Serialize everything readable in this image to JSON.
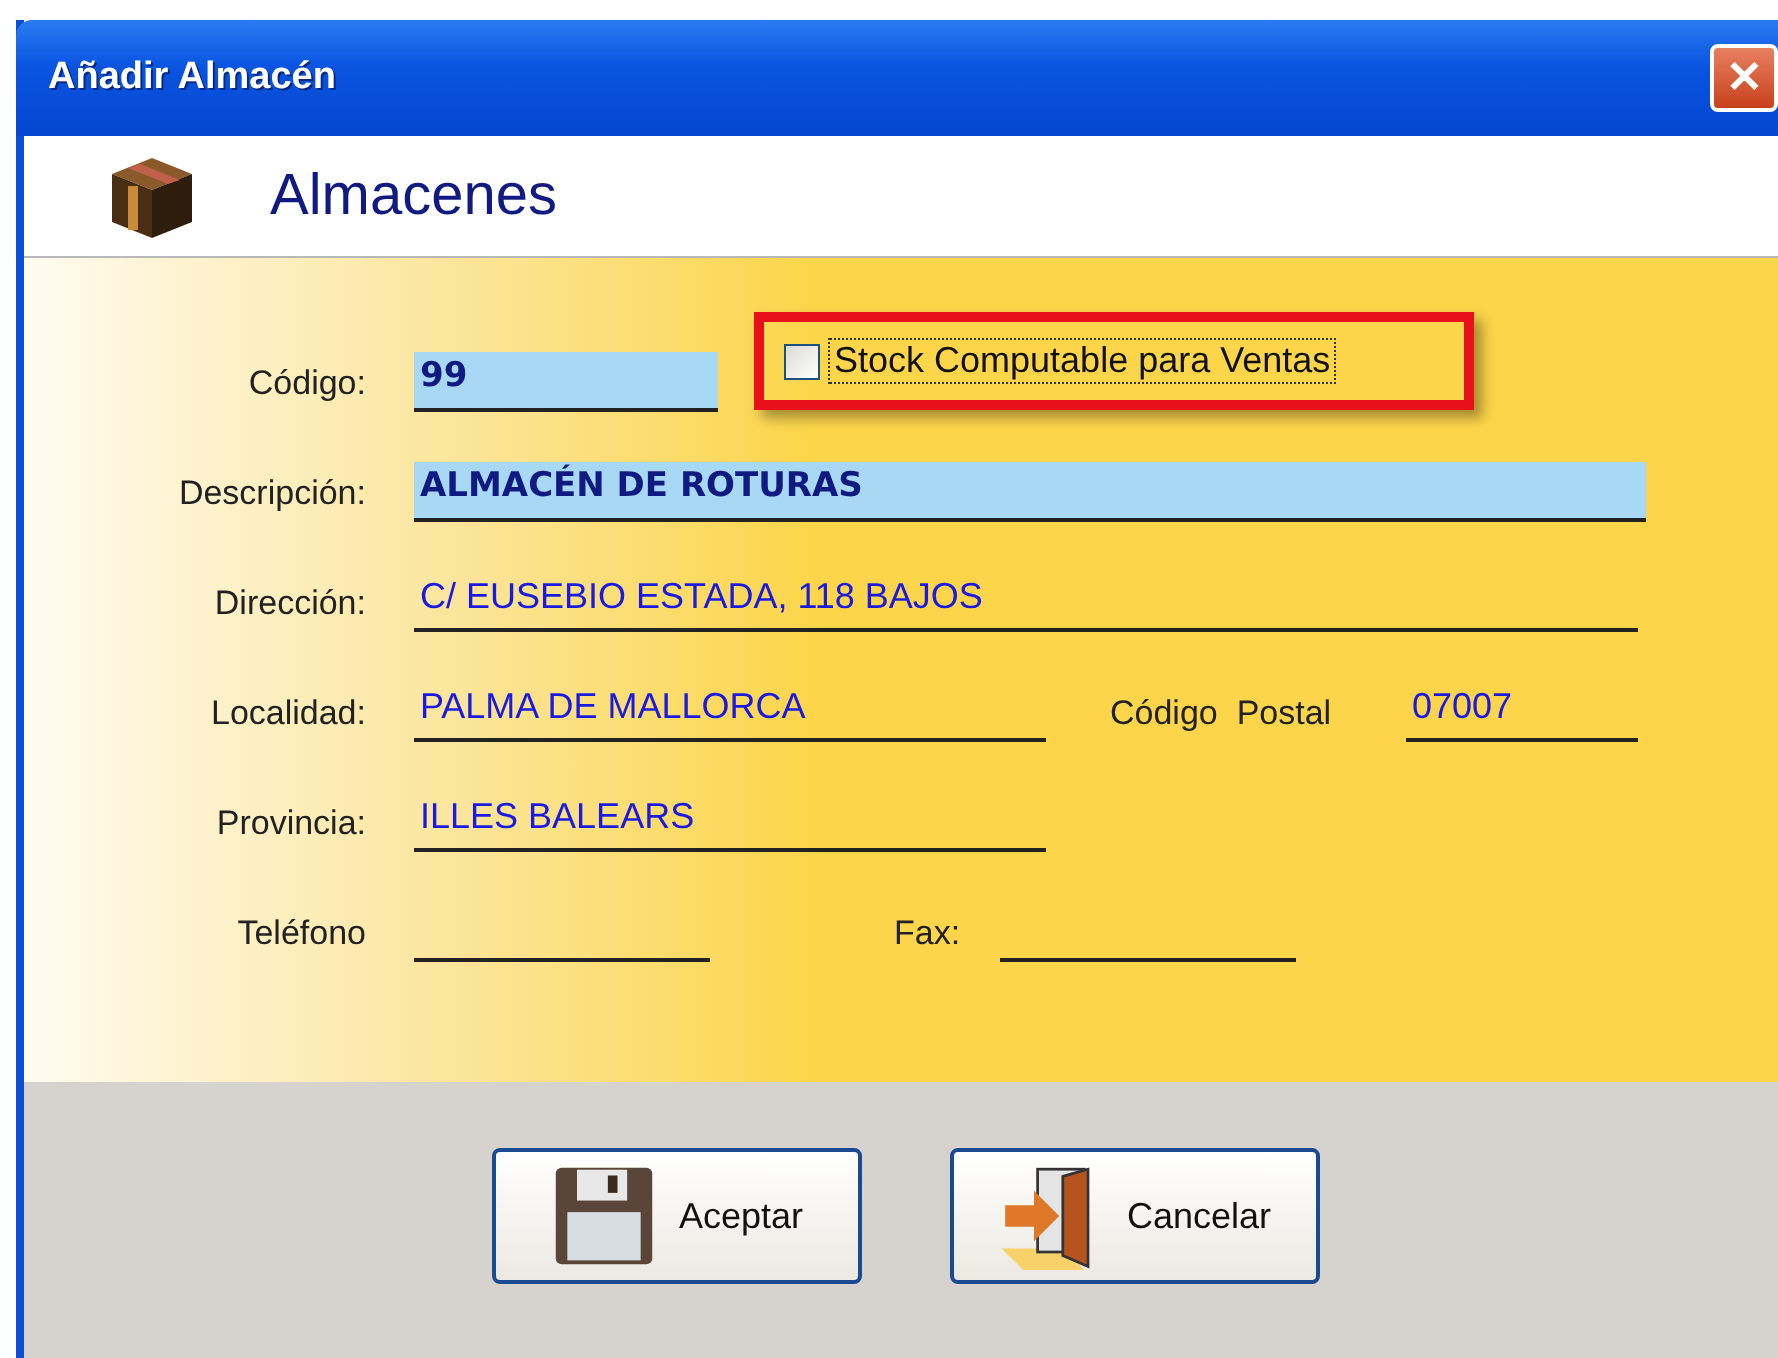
{
  "window": {
    "title": "Añadir Almacén",
    "close": "✕"
  },
  "header": {
    "title": "Almacenes"
  },
  "rows": [
    {
      "label": "Código:",
      "field": {
        "value": "99",
        "highlighted": true
      },
      "checkbox": {
        "label": "Stock Computable para Ventas",
        "checked": false,
        "annotated": true
      }
    },
    {
      "label": "Descripción:",
      "field": {
        "value": "ALMACÉN DE ROTURAS",
        "highlighted": true
      }
    },
    {
      "label": "Dirección:",
      "field": {
        "value": "C/ EUSEBIO ESTADA, 118 BAJOS",
        "highlighted": false
      }
    },
    {
      "label": "Localidad:",
      "field": {
        "value": "PALMA DE MALLORCA",
        "highlighted": false
      },
      "extra": {
        "label": "Código  Postal",
        "value": "07007"
      }
    },
    {
      "label": "Provincia:",
      "field": {
        "value": "ILLES BALEARS",
        "highlighted": false
      }
    },
    {
      "label": "Teléfono",
      "field": {
        "highlighted": false
      },
      "extra": {
        "label": "Fax:"
      }
    }
  ],
  "buttons": [
    {
      "label": "Aceptar",
      "kind": "save"
    },
    {
      "label": "Cancelar",
      "kind": "exit"
    }
  ]
}
